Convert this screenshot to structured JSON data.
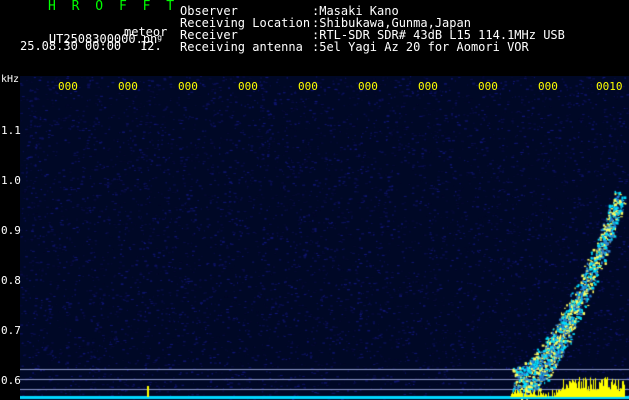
{
  "app": {
    "title": "H R O F F T",
    "filename": "UT2508300000.pn",
    "filename_suffix": "g",
    "mode": "meteor",
    "datetime": "25.08.30 00:00",
    "count": "12."
  },
  "info": {
    "labels": [
      "Observer",
      "Receiving Location",
      "Receiver",
      "Receiving antenna"
    ],
    "values": [
      ":Masaki Kano",
      ":Shibukawa,Gunma,Japan",
      ":RTL-SDR SDR# 43dB L15 114.1MHz USB",
      ":5el Yagi Az 20 for Aomori VOR"
    ]
  },
  "axis": {
    "unit": "kHz",
    "y_ticks": [
      "1.1",
      "1.0",
      "0.9",
      "0.8",
      "0.7",
      "0.6"
    ],
    "time_ticks": [
      "000",
      "000",
      "000",
      "000",
      "000",
      "000",
      "000",
      "000",
      "000",
      "0010"
    ]
  },
  "colors": {
    "title": "#00ff00",
    "info_text": "#ffffff",
    "time_ticks": "#ffff00",
    "background_noise": "#000a40",
    "signal": "#00e0ff",
    "baseline": "#ffff00"
  }
}
